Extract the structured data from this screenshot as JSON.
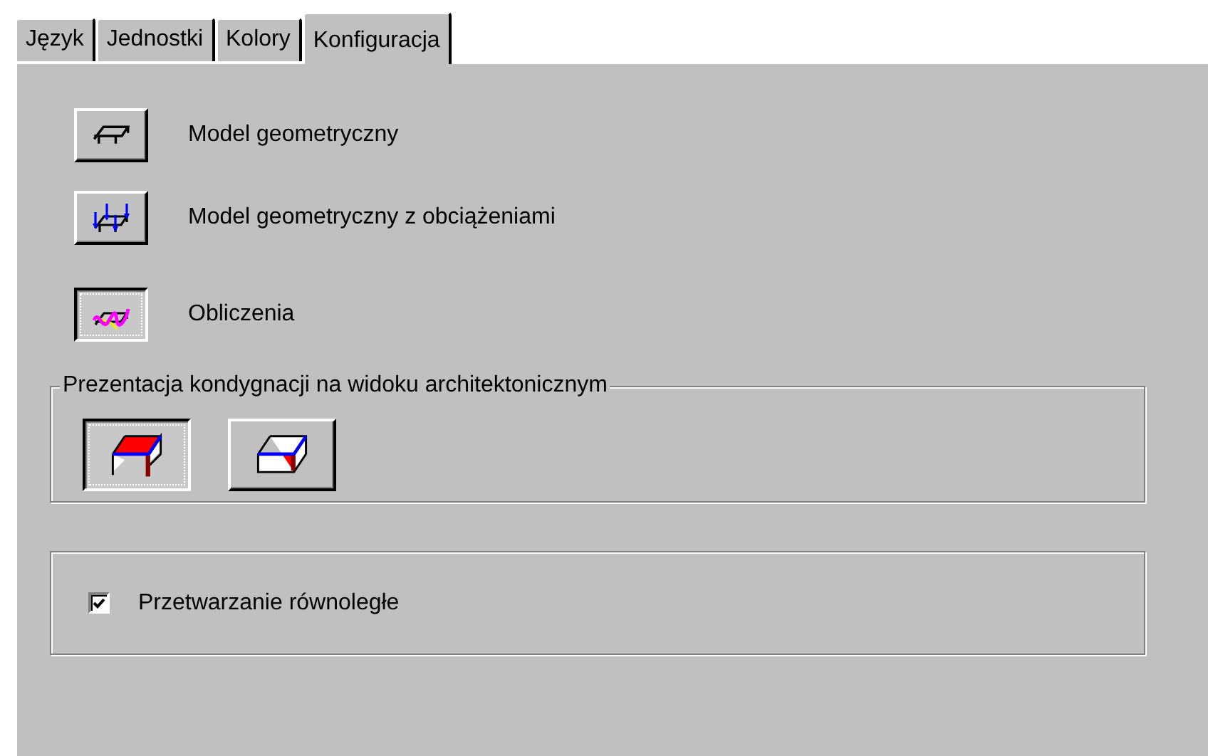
{
  "tabs": [
    {
      "label": "Język",
      "selected": false
    },
    {
      "label": "Jednostki",
      "selected": false
    },
    {
      "label": "Kolory",
      "selected": false
    },
    {
      "label": "Konfiguracja",
      "selected": true
    }
  ],
  "view_modes": [
    {
      "kind": "geometry",
      "label": "Model geometryczny",
      "selected": false
    },
    {
      "kind": "loads",
      "label": "Model geometryczny z obciążeniami",
      "selected": false
    },
    {
      "kind": "results",
      "label": "Obliczenia",
      "selected": true
    }
  ],
  "floor_presentation": {
    "title": "Prezentacja kondygnacji na widoku architektonicznym",
    "options": [
      {
        "kind": "slab",
        "selected": true
      },
      {
        "kind": "box",
        "selected": false
      }
    ]
  },
  "parallel_processing": {
    "label": "Przetwarzanie równoległe",
    "checked": true
  }
}
